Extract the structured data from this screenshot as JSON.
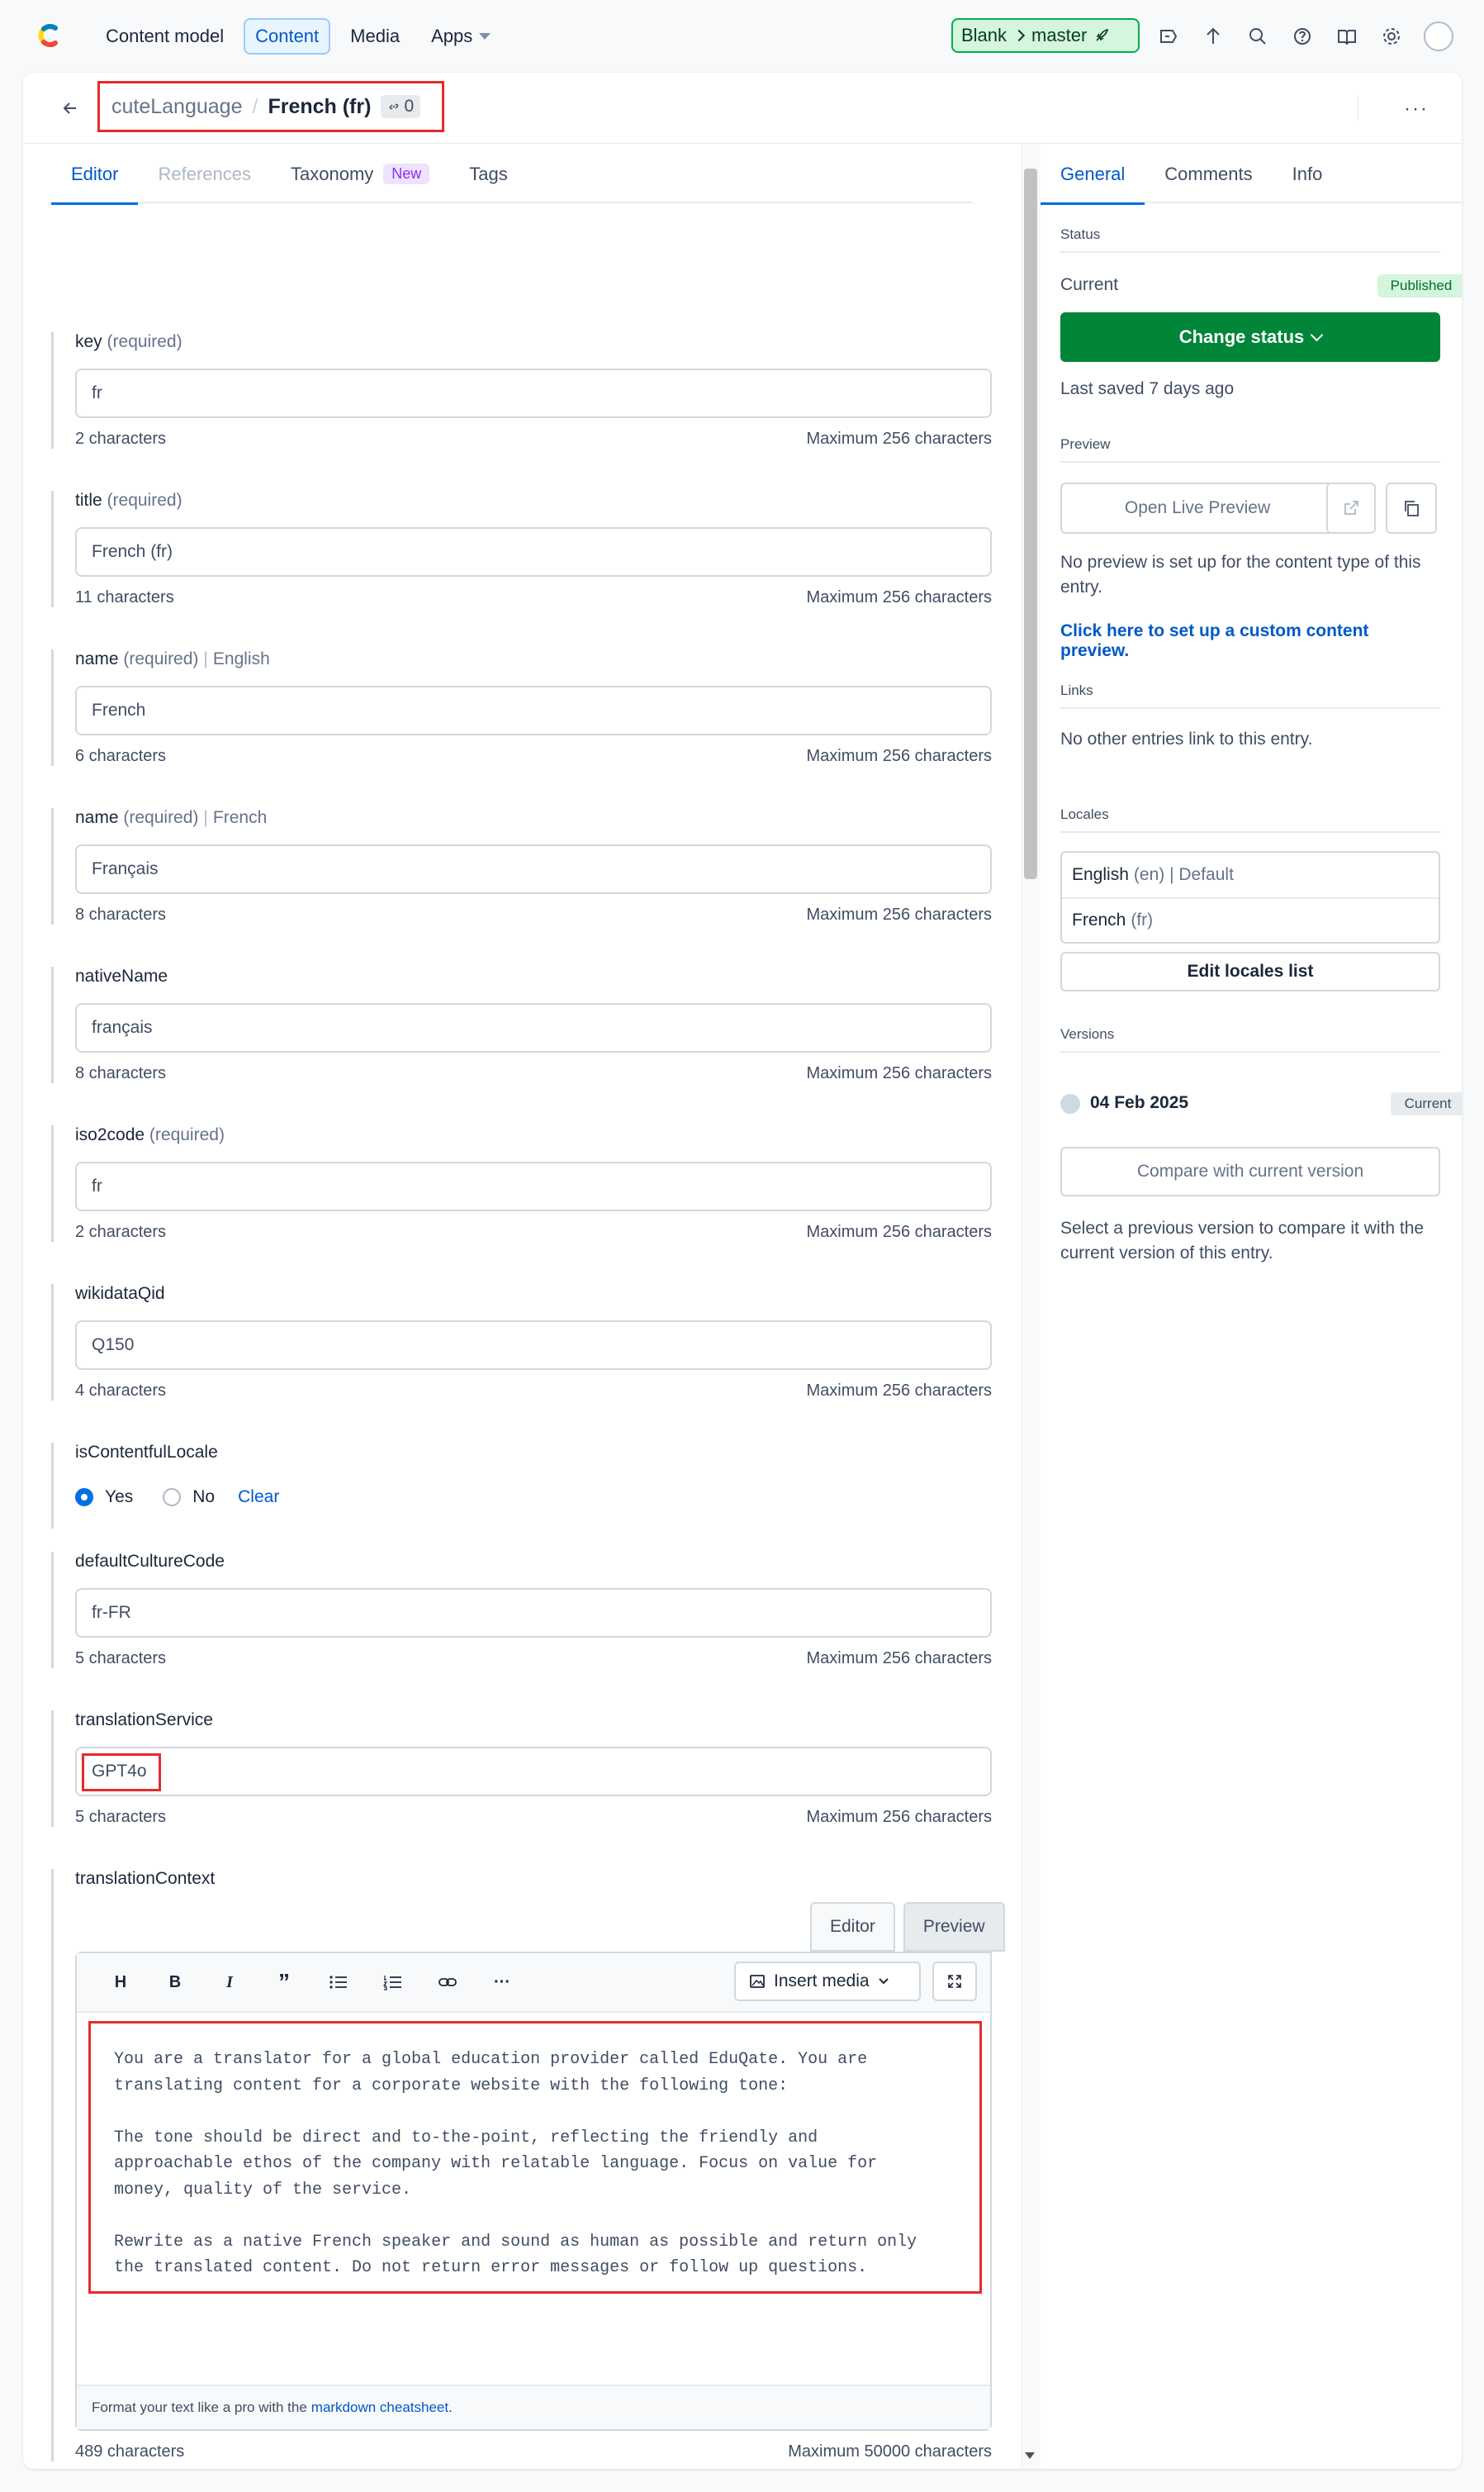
{
  "topnav": {
    "items": [
      {
        "label": "Content model",
        "active": false
      },
      {
        "label": "Content",
        "active": true
      },
      {
        "label": "Media",
        "active": false
      },
      {
        "label": "Apps",
        "active": false
      }
    ],
    "environment": {
      "space": "Blank",
      "branch": "master"
    },
    "icons": [
      "deploy-icon",
      "upload-icon",
      "search-icon",
      "help-icon",
      "book-icon",
      "settings-icon",
      "avatar"
    ]
  },
  "entry": {
    "content_type": "cuteLanguage",
    "separator": "/",
    "title": "French (fr)",
    "link_count": "0",
    "more": "···"
  },
  "tabs": [
    {
      "label": "Editor",
      "state": "active"
    },
    {
      "label": "References",
      "state": "disabled"
    },
    {
      "label": "Taxonomy",
      "state": "normal",
      "badge": "New"
    },
    {
      "label": "Tags",
      "state": "normal"
    }
  ],
  "fields": {
    "key": {
      "name": "key",
      "req": "(required)",
      "value": "fr",
      "count": "2 characters",
      "max": "Maximum 256 characters"
    },
    "title": {
      "name": "title",
      "req": "(required)",
      "value": "French (fr)",
      "count": "11 characters",
      "max": "Maximum 256 characters"
    },
    "name_en": {
      "name": "name",
      "req": "(required)",
      "locale": "English",
      "value": "French",
      "count": "6 characters",
      "max": "Maximum 256 characters"
    },
    "name_fr": {
      "name": "name",
      "req": "(required)",
      "locale": "French",
      "value": "Français",
      "count": "8 characters",
      "max": "Maximum 256 characters"
    },
    "nativeName": {
      "name": "nativeName",
      "value": "français",
      "count": "8 characters",
      "max": "Maximum 256 characters"
    },
    "iso2code": {
      "name": "iso2code",
      "req": "(required)",
      "value": "fr",
      "count": "2 characters",
      "max": "Maximum 256 characters"
    },
    "wikidataQid": {
      "name": "wikidataQid",
      "value": "Q150",
      "count": "4 characters",
      "max": "Maximum 256 characters"
    },
    "isContentfulLocale": {
      "name": "isContentfulLocale",
      "yes": "Yes",
      "no": "No",
      "clear": "Clear",
      "selected": "Yes"
    },
    "defaultCultureCode": {
      "name": "defaultCultureCode",
      "value": "fr-FR",
      "count": "5 characters",
      "max": "Maximum 256 characters"
    },
    "translationService": {
      "name": "translationService",
      "value": "GPT4o",
      "count": "5 characters",
      "max": "Maximum 256 characters"
    },
    "translationContext": {
      "name": "translationContext",
      "mode_tabs": [
        "Editor",
        "Preview"
      ],
      "toolbar": [
        "H",
        "B",
        "I",
        "”",
        "bullet-list",
        "numbered-list",
        "link",
        "···"
      ],
      "insert_media": "Insert media",
      "text": "You are a translator for a global education provider called EduQate. You are\ntranslating content for a corporate website with the following tone:\n\nThe tone should be direct and to-the-point, reflecting the friendly and\napproachable ethos of the company with relatable language. Focus on value for\nmoney, quality of the service.\n\nRewrite as a native French speaker and sound as human as possible and return only\nthe translated content. Do not return error messages or follow up questions.",
      "footer_text": "Format your text like a pro with the",
      "footer_link": "markdown cheatsheet",
      "footer_end": ".",
      "count": "489 characters",
      "max": "Maximum 50000 characters"
    }
  },
  "sidebar": {
    "tabs": [
      "General",
      "Comments",
      "Info"
    ],
    "status": {
      "heading": "Status",
      "current_label": "Current",
      "badge": "Published",
      "button": "Change status",
      "last_saved": "Last saved 7 days ago"
    },
    "preview": {
      "heading": "Preview",
      "button": "Open Live Preview",
      "note": "No preview is set up for the content type of this entry.",
      "link": "Click here to set up a custom content preview."
    },
    "links": {
      "heading": "Links",
      "note": "No other entries link to this entry."
    },
    "locales": {
      "heading": "Locales",
      "rows": [
        {
          "name": "English",
          "detail": "(en) | Default"
        },
        {
          "name": "French",
          "detail": "(fr)"
        }
      ],
      "button": "Edit locales list"
    },
    "versions": {
      "heading": "Versions",
      "date": "04 Feb 2025",
      "badge": "Current",
      "compare_button": "Compare with current version",
      "note": "Select a previous version to compare it with the current version of this entry."
    }
  },
  "colors": {
    "accent": "#036fe3",
    "primary_green": "#008539",
    "highlight_red": "#e42c2c"
  }
}
